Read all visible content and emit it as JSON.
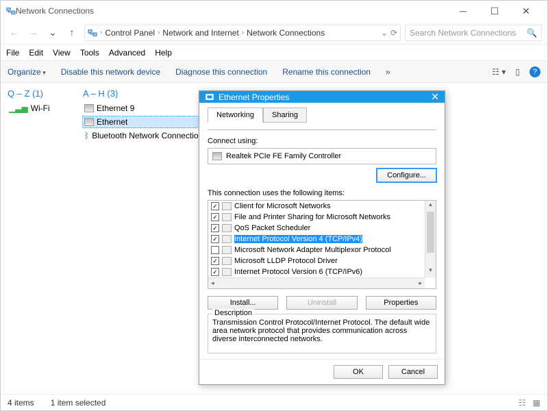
{
  "window": {
    "title": "Network Connections",
    "breadcrumb": [
      "Control Panel",
      "Network and Internet",
      "Network Connections"
    ],
    "search_placeholder": "Search Network Connections"
  },
  "menubar": [
    "File",
    "Edit",
    "View",
    "Tools",
    "Advanced",
    "Help"
  ],
  "toolbar": {
    "organize": "Organize",
    "disable": "Disable this network device",
    "diagnose": "Diagnose this connection",
    "rename": "Rename this connection",
    "more": "»"
  },
  "columns": {
    "left": {
      "header": "Q – Z (1)",
      "items": [
        {
          "label": "Wi-Fi",
          "icon": "wifi"
        }
      ]
    },
    "right": {
      "header": "A – H (3)",
      "items": [
        {
          "label": "Ethernet 9",
          "icon": "eth"
        },
        {
          "label": "Ethernet",
          "icon": "eth",
          "selected": true
        },
        {
          "label": "Bluetooth Network Connection",
          "icon": "bt"
        }
      ]
    }
  },
  "statusbar": {
    "count": "4 items",
    "selected": "1 item selected"
  },
  "dialog": {
    "title": "Ethernet Properties",
    "tabs": [
      "Networking",
      "Sharing"
    ],
    "connect_using_label": "Connect using:",
    "adapter": "Realtek PCIe FE Family Controller",
    "configure_btn": "Configure...",
    "items_label": "This connection uses the following items:",
    "items": [
      {
        "checked": true,
        "label": "Client for Microsoft Networks"
      },
      {
        "checked": true,
        "label": "File and Printer Sharing for Microsoft Networks"
      },
      {
        "checked": true,
        "label": "QoS Packet Scheduler"
      },
      {
        "checked": true,
        "label": "Internet Protocol Version 4 (TCP/IPv4)",
        "selected": true
      },
      {
        "checked": false,
        "label": "Microsoft Network Adapter Multiplexor Protocol"
      },
      {
        "checked": true,
        "label": "Microsoft LLDP Protocol Driver"
      },
      {
        "checked": true,
        "label": "Internet Protocol Version 6 (TCP/IPv6)"
      }
    ],
    "install_btn": "Install...",
    "uninstall_btn": "Uninstall",
    "properties_btn": "Properties",
    "description_label": "Description",
    "description_text": "Transmission Control Protocol/Internet Protocol. The default wide area network protocol that provides communication across diverse interconnected networks.",
    "ok_btn": "OK",
    "cancel_btn": "Cancel"
  }
}
